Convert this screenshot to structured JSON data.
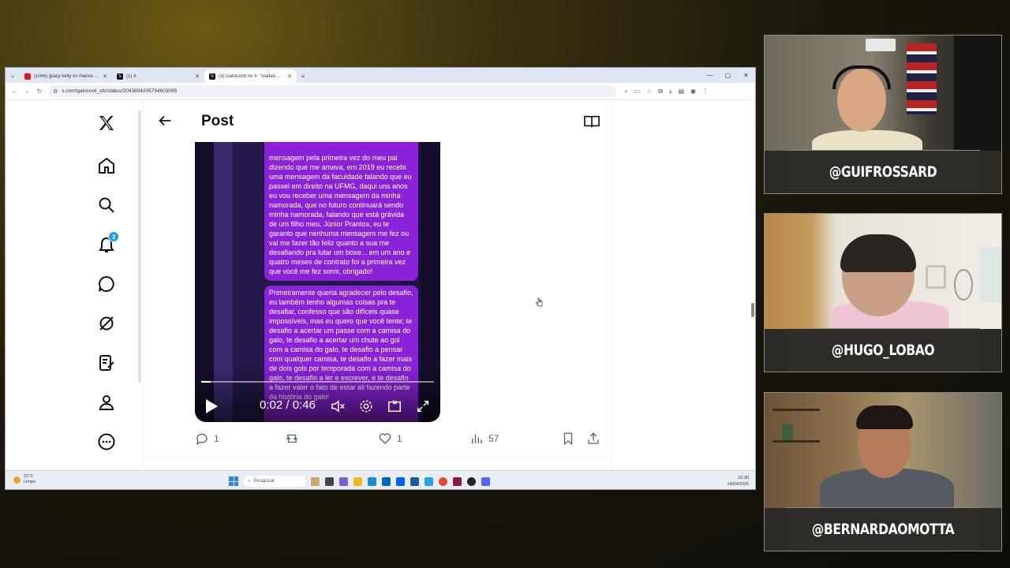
{
  "browser": {
    "tabs": [
      {
        "title": "(1006) gracy kelly os manos - Y",
        "favicon": "youtube-icon",
        "active": false
      },
      {
        "title": "(1) X",
        "favicon": "x-icon",
        "active": false
      },
      {
        "title": "(3) GaloCord no X: \"Ivadão escr",
        "favicon": "x-icon",
        "active": true
      }
    ],
    "url": "x.com/galocord_ofc/status/2043804205794603095",
    "window_controls": [
      "—",
      "▢",
      "✕"
    ]
  },
  "x": {
    "notification_count": "3",
    "post_header_title": "Post",
    "video": {
      "bubble_1_text": "mensagem pela primeira vez do meu pai dizendo que me amava, em 2019 eu recebi uma mensagem da faculdade falando que eu passei em direito na UFMG, daqui uns anos eu vou receber uma mensagem da minha namorada, que no futuro continuará sendo minha namorada, falando que está grávida de um filho meu, Júnior Prantos, eu te garanto que nenhuma mensagem me fez ou vai me fazer tão feliz quanto a sua me desafiando pra lutar um boxe... em um ano e quatro meses de contrato foi a primeira vez que você me fez sorrir, obrigado!",
      "bubble_2_text": "Primeiramente queria agradecer pelo desafio, eu também tenho algumas coisas pra te desafiar, confesso que são difíceis quase impossíveis, mas eu quero que você tente; te desafio a acertar um passe com a camisa do galo, te desafio a acertar um chute ao gol com a camisa do galo, te desafio a pensar com qualquer camisa, te desafio a fazer mais de dois gols por temporada com a camisa do galo, te desafio a ler e escrever, e te desafio a fazer valer o fato de estar ali fazendo parte da história do galo!",
      "time": "0:02 / 0:46",
      "progress": 0.04
    },
    "actions": {
      "replies": "1",
      "reposts": "",
      "likes": "1",
      "views": "57"
    }
  },
  "taskbar": {
    "weather_temp": "21°C",
    "weather_desc": "Limpo",
    "search_placeholder": "Pesquisar",
    "time": "22:30",
    "date": "14/04/2026"
  },
  "participants": [
    {
      "handle": "@GUIFROSSARD"
    },
    {
      "handle": "@HUGO_LOBAO"
    },
    {
      "handle": "@BERNARDAOMOTTA"
    }
  ],
  "colors": {
    "x_blue": "#1d9bf0",
    "bubble_purple": "#8a22d8",
    "nameplate_bg": "#2d2c28"
  }
}
